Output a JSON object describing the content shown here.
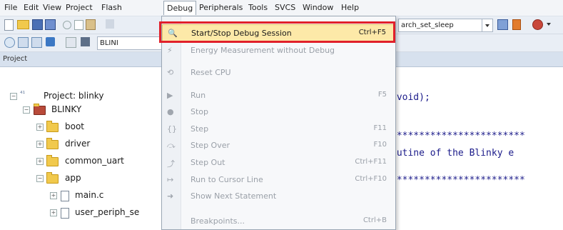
{
  "menubar": {
    "items": [
      {
        "label": "File"
      },
      {
        "label": "Edit"
      },
      {
        "label": "View"
      },
      {
        "label": "Project"
      },
      {
        "label": "Flash"
      },
      {
        "label": "Debug"
      },
      {
        "label": "Peripherals"
      },
      {
        "label": "Tools"
      },
      {
        "label": "SVCS"
      },
      {
        "label": "Window"
      },
      {
        "label": "Help"
      }
    ]
  },
  "toolbar": {
    "search_combo_value": "arch_set_sleep",
    "target_combo_value": "BLINI"
  },
  "project_panel": {
    "title": "Project",
    "tree": [
      {
        "label": "Project: blinky"
      },
      {
        "label": "BLINKY"
      },
      {
        "label": "boot"
      },
      {
        "label": "driver"
      },
      {
        "label": "common_uart"
      },
      {
        "label": "app"
      },
      {
        "label": "main.c"
      },
      {
        "label": "user_periph_se"
      }
    ]
  },
  "editor": {
    "lines": [
      {
        "text": "(void);"
      },
      {
        "text": "************************"
      },
      {
        "text": "putine of the Blinky e"
      },
      {
        "text": "************************"
      }
    ]
  },
  "debug_menu": {
    "items": [
      {
        "label": "Start/Stop Debug Session",
        "shortcut": "Ctrl+F5",
        "icon": "debug-session-icon"
      },
      {
        "label": "Energy Measurement without Debug",
        "shortcut": "",
        "icon": "energy-icon"
      },
      {
        "label": "Reset CPU",
        "shortcut": "",
        "icon": "reset-cpu-icon"
      },
      {
        "label": "Run",
        "shortcut": "F5",
        "icon": "run-icon"
      },
      {
        "label": "Stop",
        "shortcut": "",
        "icon": "stop-icon"
      },
      {
        "label": "Step",
        "shortcut": "F11",
        "icon": "step-icon"
      },
      {
        "label": "Step Over",
        "shortcut": "F10",
        "icon": "step-over-icon"
      },
      {
        "label": "Step Out",
        "shortcut": "Ctrl+F11",
        "icon": "step-out-icon"
      },
      {
        "label": "Run to Cursor Line",
        "shortcut": "Ctrl+F10",
        "icon": "run-to-cursor-icon"
      },
      {
        "label": "Show Next Statement",
        "shortcut": "",
        "icon": "next-statement-icon"
      },
      {
        "label": "Breakpoints...",
        "shortcut": "Ctrl+B",
        "icon": ""
      }
    ]
  },
  "colors": {
    "highlight": "#fde9a8",
    "callout_border": "#e1202a"
  }
}
